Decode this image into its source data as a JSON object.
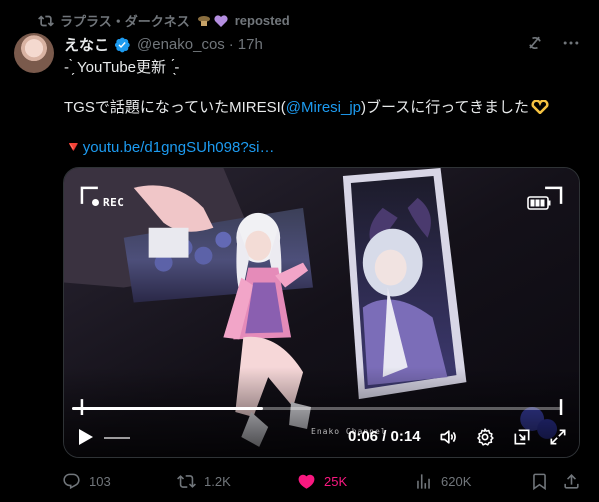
{
  "repost": {
    "label": "ラプラス・ダークネス",
    "suffix": "reposted"
  },
  "author": {
    "name": "えなこ",
    "handle": "@enako_cos",
    "time": "17h"
  },
  "post": {
    "line1": "- ̗̀ YouTube更新  ̖́-",
    "line2_prefix": "TGSで話題になっていたMIRESI(",
    "mention": "@Miresi_jp",
    "line2_suffix": ")ブースに行ってきました",
    "link_prefix": "🔻",
    "link": "youtu.be/d1gngSUh098?si…"
  },
  "video": {
    "rec_label": "REC",
    "watermark": "Enako Channel",
    "time": "0:06 / 0:14",
    "progress": 0.39
  },
  "actions": {
    "replies": "103",
    "reposts": "1.2K",
    "likes": "25K",
    "views": "620K"
  },
  "colors": {
    "accent": "#1d9bf0",
    "like": "#f91880",
    "muted": "#71767b"
  }
}
